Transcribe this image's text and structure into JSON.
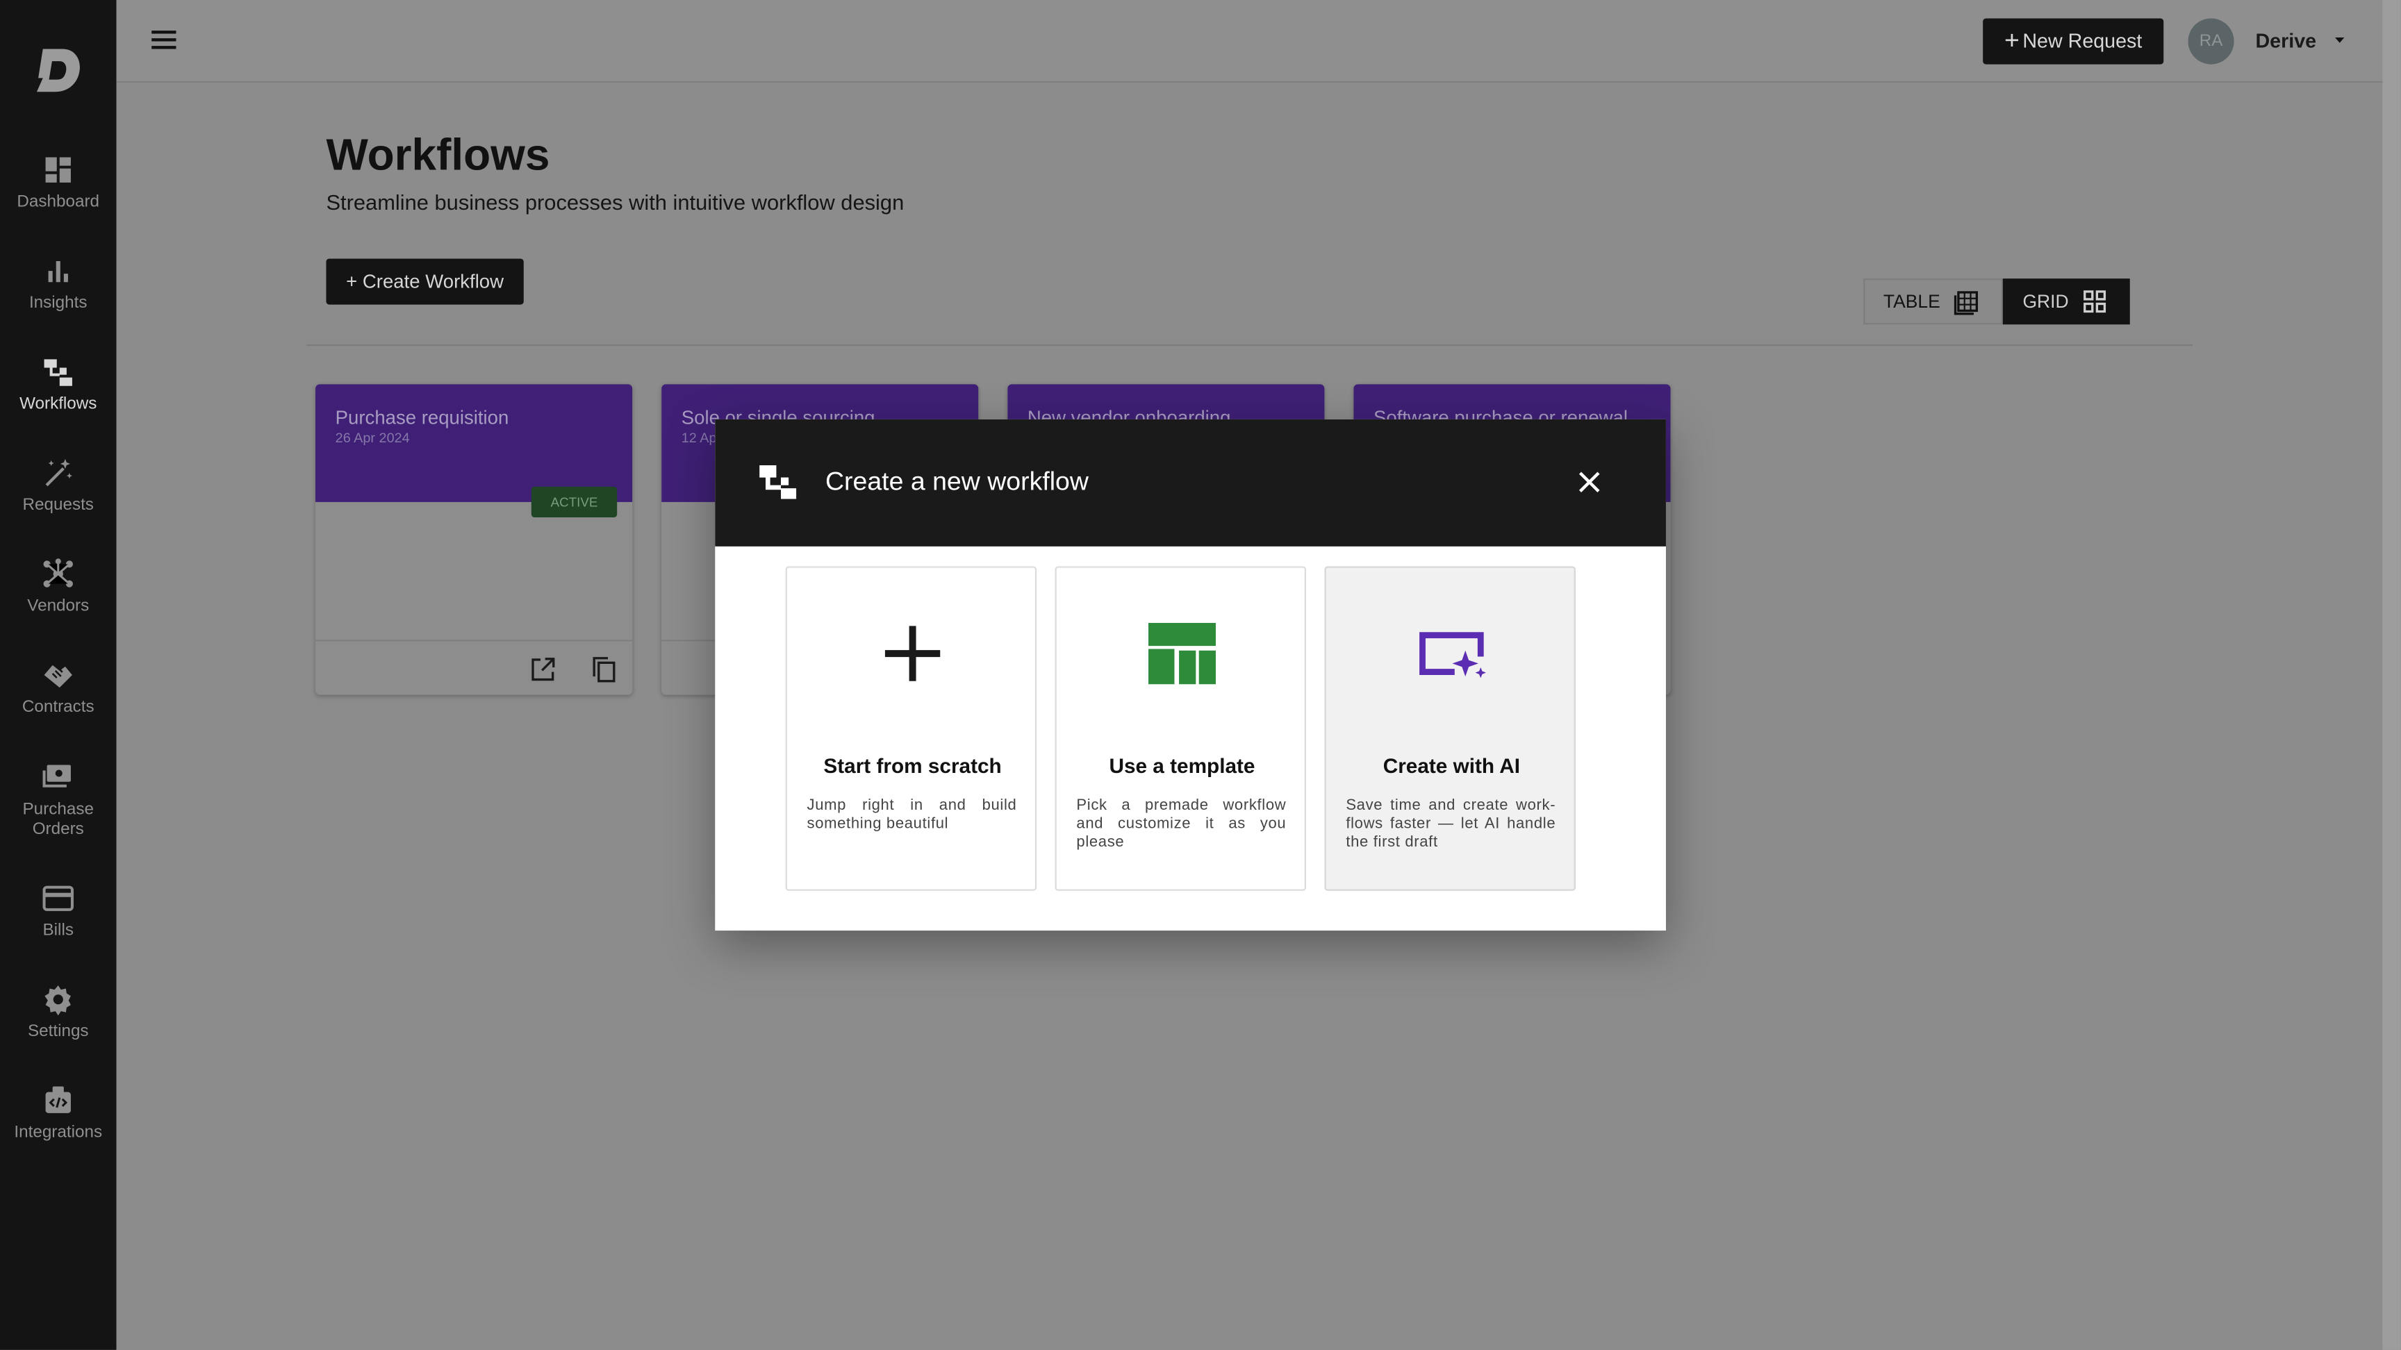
{
  "sidebar": {
    "items": [
      {
        "label": "Dashboard"
      },
      {
        "label": "Insights"
      },
      {
        "label": "Workflows"
      },
      {
        "label": "Requests"
      },
      {
        "label": "Vendors"
      },
      {
        "label": "Contracts"
      },
      {
        "label": "Purchase\nOrders"
      },
      {
        "label": "Bills"
      },
      {
        "label": "Settings"
      },
      {
        "label": "Integrations"
      }
    ],
    "active": "Workflows"
  },
  "topbar": {
    "new_request_label": "New Request",
    "avatar_initials": "RA",
    "org_name": "Derive"
  },
  "page": {
    "title": "Workflows",
    "subtitle": "Streamline business processes with intuitive workflow design",
    "create_button": "+ Create Workflow",
    "view_toggle": {
      "table": "TABLE",
      "grid": "GRID",
      "selected": "GRID"
    }
  },
  "cards": [
    {
      "title": "Purchase requisition",
      "date": "26 Apr 2024",
      "status": "ACTIVE"
    },
    {
      "title": "Sole or single sourcing",
      "date": "12 Ap"
    },
    {
      "title": "New vendor onboarding",
      "date": ""
    },
    {
      "title": "Software purchase or renewal",
      "date": ""
    }
  ],
  "modal": {
    "title": "Create a new workflow",
    "options": [
      {
        "title": "Start from scratch",
        "description": "Jump right in and build something beautiful",
        "icon": "plus-icon"
      },
      {
        "title": "Use a template",
        "description": "Pick a premade workflow and customize it as you please",
        "icon": "template-icon"
      },
      {
        "title": "Create with AI",
        "description": "Save time and create work-flows faster — let AI handle the first draft",
        "icon": "ai-sparkle-icon"
      }
    ]
  },
  "colors": {
    "sidebar_bg": "#141414",
    "card_header": "#3f2076",
    "active_badge": "#1f4524",
    "template_green": "#2e8b3a",
    "ai_purple": "#5b2db3",
    "overlay_bg": "#8c8c8c"
  }
}
